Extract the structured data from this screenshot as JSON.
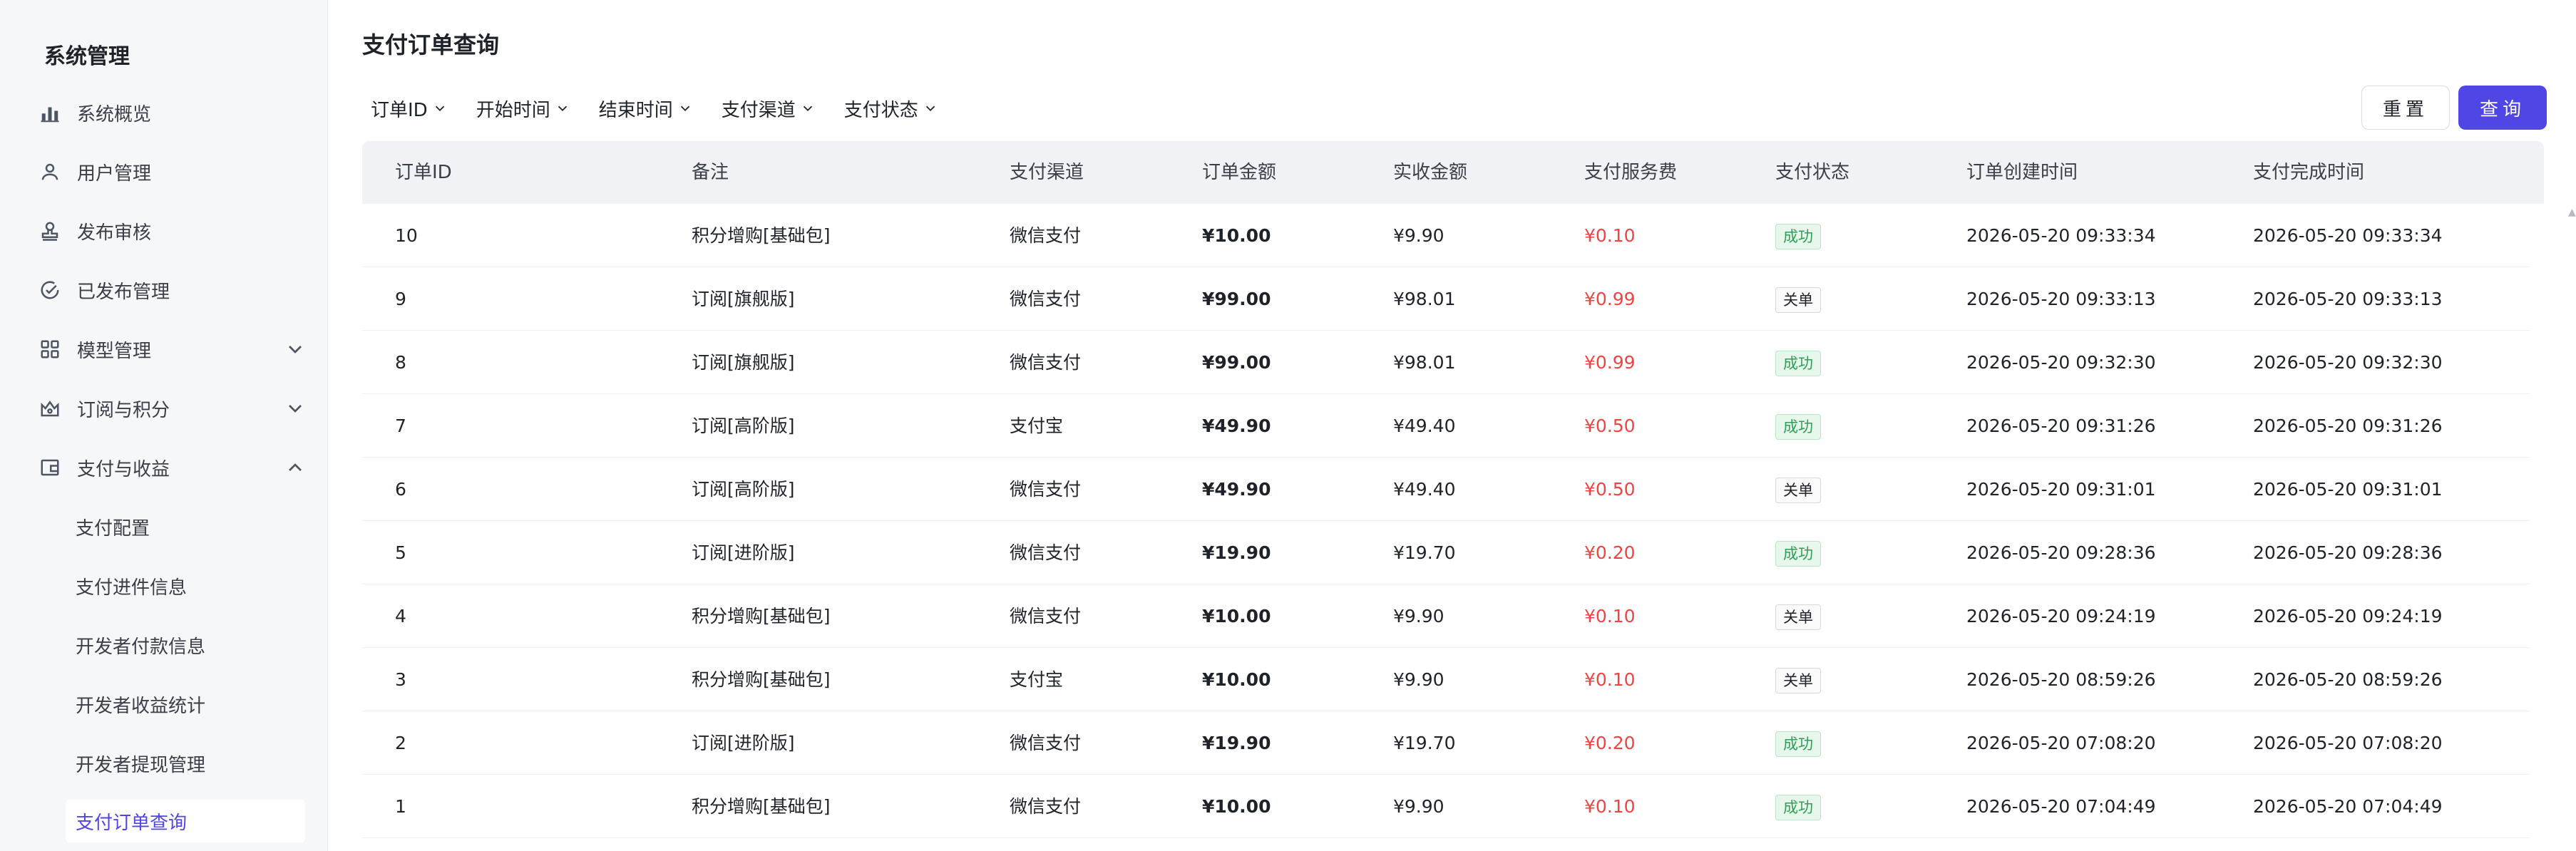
{
  "sidebar": {
    "title": "系统管理",
    "items": [
      {
        "label": "系统概览",
        "icon": "bar-chart-icon"
      },
      {
        "label": "用户管理",
        "icon": "user-icon"
      },
      {
        "label": "发布审核",
        "icon": "stamp-icon"
      },
      {
        "label": "已发布管理",
        "icon": "check-circle-icon"
      },
      {
        "label": "模型管理",
        "icon": "grid-icon",
        "expandable": true,
        "expanded": false
      },
      {
        "label": "订阅与积分",
        "icon": "crown-icon",
        "expandable": true,
        "expanded": false
      },
      {
        "label": "支付与收益",
        "icon": "wallet-icon",
        "expandable": true,
        "expanded": true
      }
    ],
    "subitems": [
      {
        "label": "支付配置"
      },
      {
        "label": "支付进件信息"
      },
      {
        "label": "开发者付款信息"
      },
      {
        "label": "开发者收益统计"
      },
      {
        "label": "开发者提现管理"
      },
      {
        "label": "支付订单查询",
        "active": true
      }
    ]
  },
  "main": {
    "title": "支付订单查询",
    "filters": [
      "订单ID",
      "开始时间",
      "结束时间",
      "支付渠道",
      "支付状态"
    ],
    "reset_label": "重置",
    "query_label": "查询",
    "columns": [
      "订单ID",
      "备注",
      "支付渠道",
      "订单金额",
      "实收金额",
      "支付服务费",
      "支付状态",
      "订单创建时间",
      "支付完成时间"
    ],
    "rows": [
      {
        "id": "10",
        "note": "积分增购[基础包]",
        "channel": "微信支付",
        "amount": "¥10.00",
        "received": "¥9.90",
        "fee": "¥0.10",
        "status": "成功",
        "created": "2026-05-20 09:33:34",
        "completed": "2026-05-20 09:33:34"
      },
      {
        "id": "9",
        "note": "订阅[旗舰版]",
        "channel": "微信支付",
        "amount": "¥99.00",
        "received": "¥98.01",
        "fee": "¥0.99",
        "status": "关单",
        "created": "2026-05-20 09:33:13",
        "completed": "2026-05-20 09:33:13"
      },
      {
        "id": "8",
        "note": "订阅[旗舰版]",
        "channel": "微信支付",
        "amount": "¥99.00",
        "received": "¥98.01",
        "fee": "¥0.99",
        "status": "成功",
        "created": "2026-05-20 09:32:30",
        "completed": "2026-05-20 09:32:30"
      },
      {
        "id": "7",
        "note": "订阅[高阶版]",
        "channel": "支付宝",
        "amount": "¥49.90",
        "received": "¥49.40",
        "fee": "¥0.50",
        "status": "成功",
        "created": "2026-05-20 09:31:26",
        "completed": "2026-05-20 09:31:26"
      },
      {
        "id": "6",
        "note": "订阅[高阶版]",
        "channel": "微信支付",
        "amount": "¥49.90",
        "received": "¥49.40",
        "fee": "¥0.50",
        "status": "关单",
        "created": "2026-05-20 09:31:01",
        "completed": "2026-05-20 09:31:01"
      },
      {
        "id": "5",
        "note": "订阅[进阶版]",
        "channel": "微信支付",
        "amount": "¥19.90",
        "received": "¥19.70",
        "fee": "¥0.20",
        "status": "成功",
        "created": "2026-05-20 09:28:36",
        "completed": "2026-05-20 09:28:36"
      },
      {
        "id": "4",
        "note": "积分增购[基础包]",
        "channel": "微信支付",
        "amount": "¥10.00",
        "received": "¥9.90",
        "fee": "¥0.10",
        "status": "关单",
        "created": "2026-05-20 09:24:19",
        "completed": "2026-05-20 09:24:19"
      },
      {
        "id": "3",
        "note": "积分增购[基础包]",
        "channel": "支付宝",
        "amount": "¥10.00",
        "received": "¥9.90",
        "fee": "¥0.10",
        "status": "关单",
        "created": "2026-05-20 08:59:26",
        "completed": "2026-05-20 08:59:26"
      },
      {
        "id": "2",
        "note": "订阅[进阶版]",
        "channel": "微信支付",
        "amount": "¥19.90",
        "received": "¥19.70",
        "fee": "¥0.20",
        "status": "成功",
        "created": "2026-05-20 07:08:20",
        "completed": "2026-05-20 07:08:20"
      },
      {
        "id": "1",
        "note": "积分增购[基础包]",
        "channel": "微信支付",
        "amount": "¥10.00",
        "received": "¥9.90",
        "fee": "¥0.10",
        "status": "成功",
        "created": "2026-05-20 07:04:49",
        "completed": "2026-05-20 07:04:49"
      }
    ]
  },
  "colors": {
    "accent": "#4f46e5",
    "fee": "#f04444",
    "success": "#2f9e55"
  }
}
